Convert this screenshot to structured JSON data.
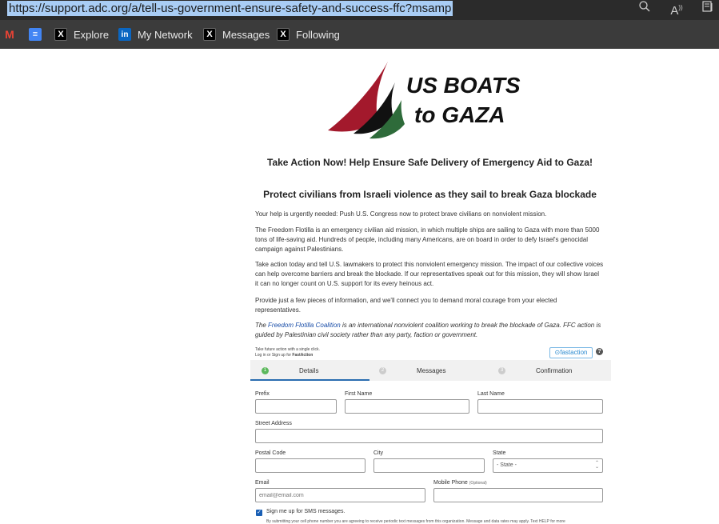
{
  "browser": {
    "url": "https://support.adc.org/a/tell-us-government-ensure-safety-and-success-ffc?msamp",
    "zoom_icon": "zoom-icon",
    "read_aloud_icon": "read-aloud-icon",
    "reader_icon": "reader-view-icon"
  },
  "bookmarks": [
    {
      "label": "",
      "icon": "gmail-icon"
    },
    {
      "label": "",
      "icon": "docs-icon"
    },
    {
      "label": "Explore",
      "icon": "x-icon"
    },
    {
      "label": "My Network",
      "icon": "linkedin-icon"
    },
    {
      "label": "Messages",
      "icon": "x-icon"
    },
    {
      "label": "Following",
      "icon": "x-icon"
    }
  ],
  "logo": {
    "line1": "US BOATS",
    "line2": "to GAZA",
    "colors": {
      "red": "#a3192c",
      "black": "#111111",
      "green": "#2e6b3a"
    }
  },
  "headline": "Take Action Now! Help Ensure Safe Delivery of Emergency Aid to Gaza!",
  "subheadline": "Protect civilians from Israeli violence as they sail to break Gaza blockade",
  "paragraphs": {
    "p1": "Your help is urgently needed: Push U.S. Congress now to protect brave civilians on nonviolent mission.",
    "p2": "The Freedom Flotilla is an emergency civilian aid mission, in which multiple ships are sailing to Gaza with more than 5000 tons of life-saving aid. Hundreds of people, including many Americans, are on board in order to defy Israel's genocidal campaign against Palestinians.",
    "p3": "Take action today and tell U.S. lawmakers to protect this nonviolent emergency mission. The impact of our collective voices can help overcome barriers and break the blockade. If our representatives speak out for this mission, they will show Israel it can no longer count on U.S. support for its every heinous act.",
    "p4": "Provide just a few pieces of information, and we'll connect you to demand moral courage from your elected representatives.",
    "p5_prefix": "The ",
    "p5_link": "Freedom Flotilla Coalition",
    "p5_suffix": " is an international nonviolent coalition working to break the blockade of Gaza. FFC action is guided by Palestinian civil society rather than any party, faction or government."
  },
  "fastaction": {
    "line1": "Take future action with a single click.",
    "line2_prefix": "Log in or Sign up for ",
    "line2_brand": "FastAction",
    "badge": "⊙fastaction",
    "help": "?"
  },
  "steps": [
    {
      "num": "1",
      "label": "Details"
    },
    {
      "num": "2",
      "label": "Messages"
    },
    {
      "num": "3",
      "label": "Confirmation"
    }
  ],
  "form": {
    "prefix": "Prefix",
    "first_name": "First Name",
    "last_name": "Last Name",
    "street": "Street Address",
    "postal": "Postal Code",
    "city": "City",
    "state": "State",
    "state_value": "- State -",
    "email": "Email",
    "email_placeholder": "email@email.com",
    "mobile": "Mobile Phone",
    "optional": "(Optional)",
    "sms_label": "Sign me up for SMS messages.",
    "sms_fine": "By submitting your cell phone number you are agreeing to receive periodic text messages from this organization. Message and data rates may apply. Text HELP for more"
  }
}
